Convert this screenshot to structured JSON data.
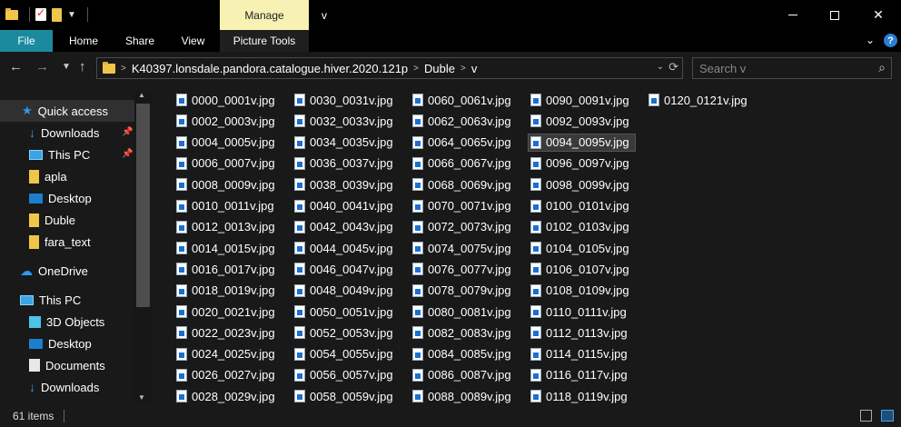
{
  "window": {
    "title": "v",
    "context_tab": "Manage",
    "controls": {
      "minimize": "minimize",
      "maximize": "maximize",
      "close": "✕"
    }
  },
  "ribbon": {
    "tabs": [
      "File",
      "Home",
      "Share",
      "View",
      "Picture Tools"
    ],
    "collapse": "⌄",
    "help": "?"
  },
  "address": {
    "breadcrumbs": [
      "K40397.lonsdale.pandora.catalogue.hiver.2020.121p",
      "Duble",
      "v"
    ],
    "search_placeholder": "Search v"
  },
  "nav": {
    "items": [
      {
        "label": "Quick access",
        "icon": "star-icon"
      },
      {
        "label": "Downloads",
        "icon": "download-icon",
        "pinned": true
      },
      {
        "label": "This PC",
        "icon": "pc-icon",
        "pinned": true
      },
      {
        "label": "apla",
        "icon": "folder-icon"
      },
      {
        "label": "Desktop",
        "icon": "desktop-icon"
      },
      {
        "label": "Duble",
        "icon": "folder-icon"
      },
      {
        "label": "fara_text",
        "icon": "folder-icon"
      },
      {
        "label": "OneDrive",
        "icon": "cloud-icon"
      },
      {
        "label": "This PC",
        "icon": "pc-icon"
      },
      {
        "label": "3D Objects",
        "icon": "cube-icon"
      },
      {
        "label": "Desktop",
        "icon": "desktop-icon"
      },
      {
        "label": "Documents",
        "icon": "documents-icon"
      },
      {
        "label": "Downloads",
        "icon": "download-icon"
      }
    ]
  },
  "files": {
    "columns": [
      [
        "0000_0001v.jpg",
        "0002_0003v.jpg",
        "0004_0005v.jpg",
        "0006_0007v.jpg",
        "0008_0009v.jpg",
        "0010_0011v.jpg",
        "0012_0013v.jpg",
        "0014_0015v.jpg",
        "0016_0017v.jpg",
        "0018_0019v.jpg",
        "0020_0021v.jpg",
        "0022_0023v.jpg",
        "0024_0025v.jpg",
        "0026_0027v.jpg",
        "0028_0029v.jpg"
      ],
      [
        "0030_0031v.jpg",
        "0032_0033v.jpg",
        "0034_0035v.jpg",
        "0036_0037v.jpg",
        "0038_0039v.jpg",
        "0040_0041v.jpg",
        "0042_0043v.jpg",
        "0044_0045v.jpg",
        "0046_0047v.jpg",
        "0048_0049v.jpg",
        "0050_0051v.jpg",
        "0052_0053v.jpg",
        "0054_0055v.jpg",
        "0056_0057v.jpg",
        "0058_0059v.jpg"
      ],
      [
        "0060_0061v.jpg",
        "0062_0063v.jpg",
        "0064_0065v.jpg",
        "0066_0067v.jpg",
        "0068_0069v.jpg",
        "0070_0071v.jpg",
        "0072_0073v.jpg",
        "0074_0075v.jpg",
        "0076_0077v.jpg",
        "0078_0079v.jpg",
        "0080_0081v.jpg",
        "0082_0083v.jpg",
        "0084_0085v.jpg",
        "0086_0087v.jpg",
        "0088_0089v.jpg"
      ],
      [
        "0090_0091v.jpg",
        "0092_0093v.jpg",
        "0094_0095v.jpg",
        "0096_0097v.jpg",
        "0098_0099v.jpg",
        "0100_0101v.jpg",
        "0102_0103v.jpg",
        "0104_0105v.jpg",
        "0106_0107v.jpg",
        "0108_0109v.jpg",
        "0110_0111v.jpg",
        "0112_0113v.jpg",
        "0114_0115v.jpg",
        "0116_0117v.jpg",
        "0118_0119v.jpg"
      ],
      [
        "0120_0121v.jpg"
      ]
    ],
    "selected": "0094_0095v.jpg"
  },
  "status": {
    "item_count": "61 items"
  },
  "colors": {
    "background": "#191919",
    "accent_file_tab": "#1b8a9f",
    "manage_tab": "#f7f2b4",
    "folder": "#f0c649",
    "icon_blue": "#2b9af3"
  }
}
